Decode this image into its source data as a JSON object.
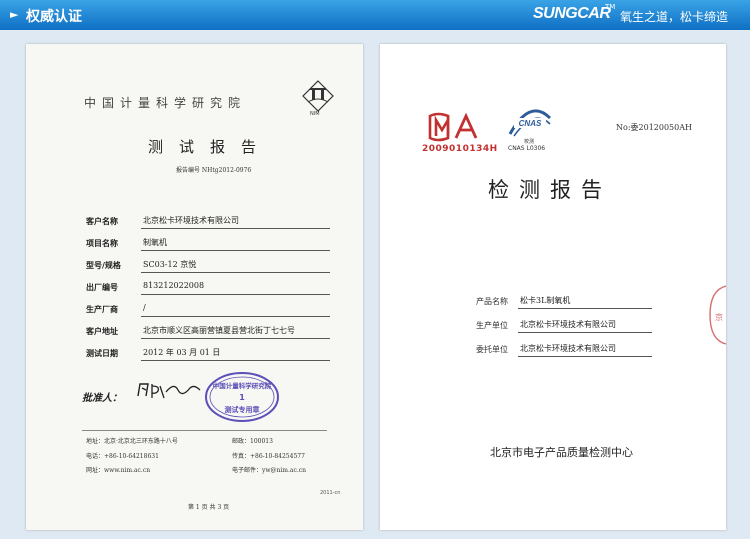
{
  "header": {
    "arrow": "►",
    "title": "权威认证",
    "brand": "SUNGCAR",
    "tm": "TM",
    "slogan": "氧生之道，松卡缔造"
  },
  "left_report": {
    "institute": "中国计量科学研究院",
    "logo_text": "NIM",
    "title": "测试报告",
    "report_no": "报告编号 NHtg2012-0976",
    "fields": [
      {
        "label": "客户名称",
        "value": "北京松卡环境技术有限公司"
      },
      {
        "label": "项目名称",
        "value": "制氧机"
      },
      {
        "label": "型号/规格",
        "value": "SC03-12 京悦"
      },
      {
        "label": "出厂编号",
        "value": "813212022008"
      },
      {
        "label": "生产厂商",
        "value": "/"
      },
      {
        "label": "客户地址",
        "value": "北京市顺义区高丽营镇夏县营北街丁七七号"
      },
      {
        "label": "测试日期",
        "value": "2012 年 03 月 01 日"
      }
    ],
    "approve_label": "批准人：",
    "stamp": {
      "top": "中国计量科学研究院",
      "middle": "1",
      "bottom": "测试专用章"
    },
    "address": {
      "addr": "地址：北京·北京北三环东路十八号",
      "zip": "邮政：100013",
      "tel": "电话：+86-10-64218631",
      "fax": "传真：+86-10-84254577",
      "web": "网址：www.nim.ac.cn",
      "email": "电子邮件：yw@nim.ac.cn"
    },
    "code": "2011-cn",
    "page": "第 1 页   共 3 页"
  },
  "right_report": {
    "cma_no": "2009010134H",
    "cnas_cn": "校测",
    "cnas_no": "CNAS L0306",
    "report_no": "No:委20120050AH",
    "title": "检测报告",
    "fields": [
      {
        "label": "产品名称",
        "value": "松卡3L制氧机"
      },
      {
        "label": "生产单位",
        "value": "北京松卡环境技术有限公司"
      },
      {
        "label": "委托单位",
        "value": "北京松卡环境技术有限公司"
      }
    ],
    "center": "北京市电子产品质量检测中心",
    "seal_text": "京",
    "colors": {
      "cma_red": "#c23030",
      "cnas_blue": "#2e5c9a",
      "stamp_blue": "#5b4fb8"
    }
  }
}
